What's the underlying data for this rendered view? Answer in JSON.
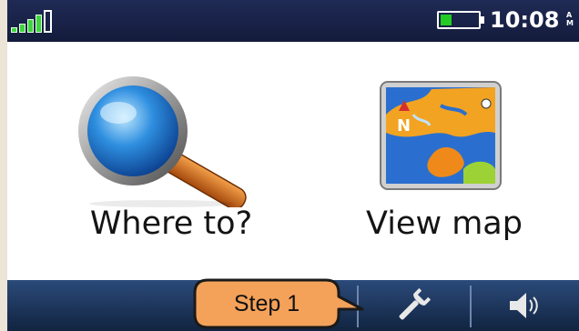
{
  "status_bar": {
    "signal_bars_filled": 4,
    "signal_bars_total": 5,
    "battery_level": 0.3,
    "clock_time": "10:08",
    "clock_ampm_top": "A",
    "clock_ampm_bottom": "M"
  },
  "main_menu": {
    "where_to_label": "Where to?",
    "view_map_label": "View map"
  },
  "bottom_bar": {
    "settings_icon": "wrench-icon",
    "volume_icon": "speaker-icon"
  },
  "callout": {
    "label": "Step 1",
    "color": "#f4a15a"
  },
  "colors": {
    "status_bar": "#1a2148",
    "bottom_bar": "#1e3560",
    "signal": "#3fd43f",
    "battery": "#22cc22"
  }
}
